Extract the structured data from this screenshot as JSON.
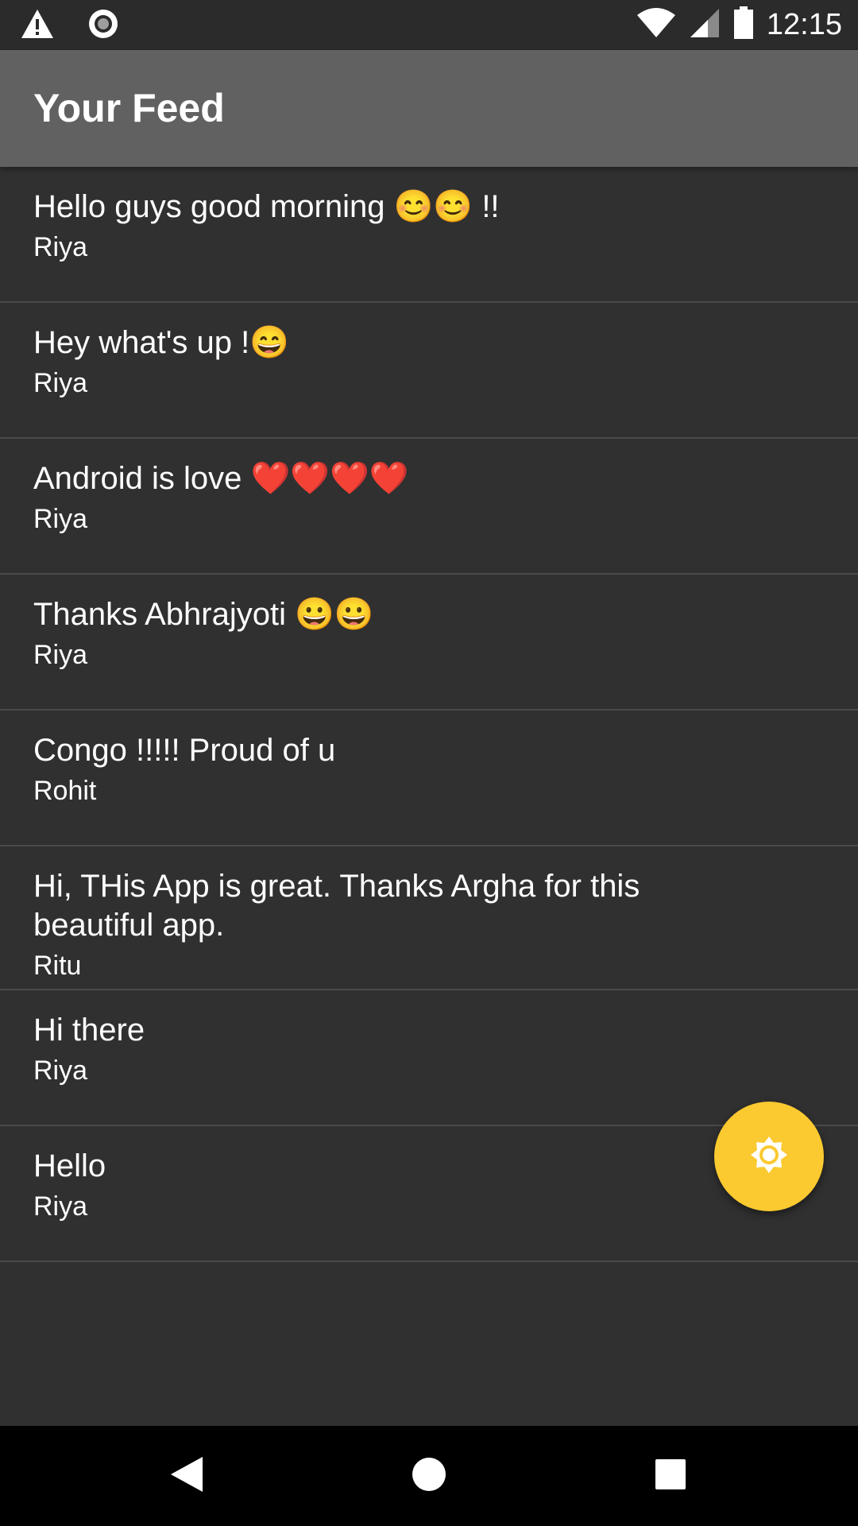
{
  "status_bar": {
    "time": "12:15",
    "left_icons": [
      "warning-icon",
      "record-icon"
    ],
    "right_icons": [
      "wifi-icon",
      "signal-icon",
      "battery-icon"
    ]
  },
  "app_bar": {
    "title": "Your Feed",
    "color": "#616161"
  },
  "feed": {
    "items": [
      {
        "message": "Hello guys good morning 😊😊 !!",
        "author": "Riya"
      },
      {
        "message": "Hey what's up !😄",
        "author": "Riya"
      },
      {
        "message": "Android is love ❤️❤️❤️❤️",
        "author": "Riya"
      },
      {
        "message": "Thanks Abhrajyoti 😀😀",
        "author": "Riya"
      },
      {
        "message": "Congo !!!!! Proud of u",
        "author": "Rohit"
      },
      {
        "message": "Hi, THis App is great. Thanks Argha for this beautiful app.",
        "author": "Ritu"
      },
      {
        "message": "Hi there",
        "author": "Riya"
      },
      {
        "message": "Hello",
        "author": "Riya"
      }
    ]
  },
  "fab": {
    "icon": "brightness-icon",
    "color": "#fbc930"
  },
  "nav_bar": {
    "buttons": [
      "back-icon",
      "home-icon",
      "recents-icon"
    ]
  }
}
